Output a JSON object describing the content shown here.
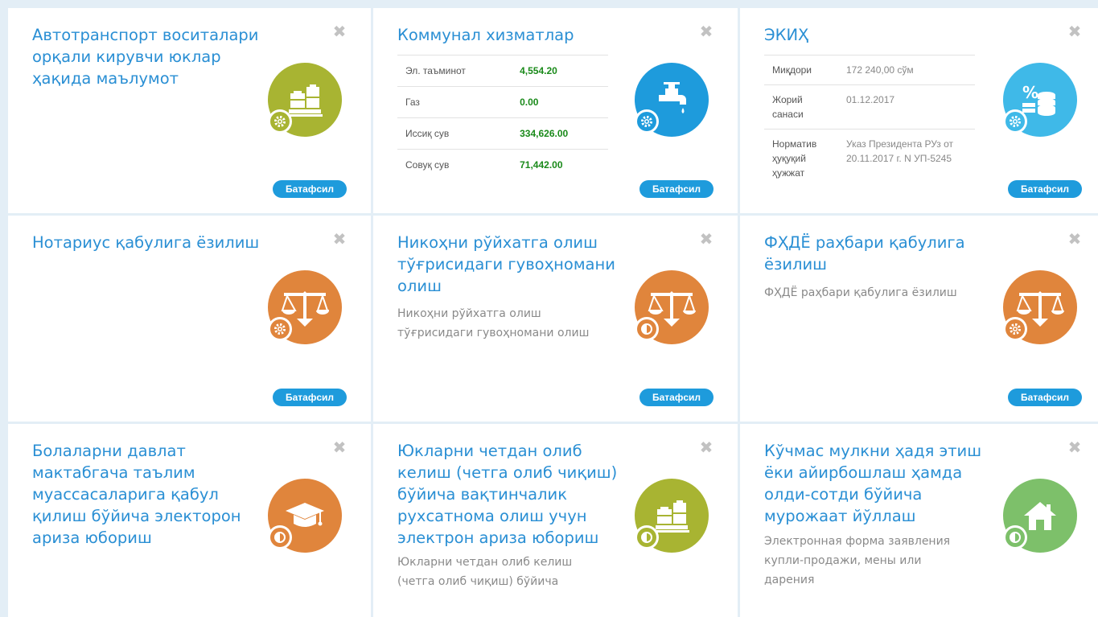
{
  "more_label": "Батафсил",
  "close_glyph": "✖",
  "cards": {
    "c1": {
      "title": "Автотранспорт воситалари орқали кирувчи юклар ҳақида маълумот",
      "icon": "cargo-icon",
      "badge": "gear-icon",
      "color": "#a8b432"
    },
    "c2": {
      "title": "Коммунал хизматлар",
      "icon": "water-tap-icon",
      "badge": "gear-icon",
      "color": "#1e9bdc",
      "rows": [
        {
          "label": "Эл. таъминот",
          "value": "4,554.20"
        },
        {
          "label": "Газ",
          "value": "0.00"
        },
        {
          "label": "Иссиқ сув",
          "value": "334,626.00"
        },
        {
          "label": "Совуқ сув",
          "value": "71,442.00"
        }
      ]
    },
    "c3": {
      "title": "ЭКИҲ",
      "icon": "percent-coins-icon",
      "badge": "gear-icon",
      "color": "#3fb9e8",
      "rows": [
        {
          "label": "Миқдори",
          "value": "172 240,00 сўм"
        },
        {
          "label": "Жорий санаси",
          "value": "01.12.2017"
        },
        {
          "label": "Норматив ҳуқуқий ҳужжат",
          "value": "Указ Президента РУз от 20.11.2017 г. N УП-5245"
        }
      ]
    },
    "c4": {
      "title": "Нотариус қабулига ёзилиш",
      "icon": "scales-icon",
      "badge": "gear-icon",
      "color": "#e0853c"
    },
    "c5": {
      "title": "Никоҳни рўйхатга олиш тўғрисидаги гувоҳномани олиш",
      "desc": "Никоҳни рўйхатга олиш тўғрисидаги гувоҳномани олиш",
      "icon": "scales-icon",
      "badge": "half-circle-icon",
      "color": "#e0853c"
    },
    "c6": {
      "title": "ФҲДЁ раҳбари қабулига ёзилиш",
      "desc": "ФҲДЁ раҳбари қабулига ёзилиш",
      "icon": "scales-icon",
      "badge": "gear-icon",
      "color": "#e0853c"
    },
    "c7": {
      "title": "Болаларни давлат мактабгача таълим муассасаларига қабул қилиш бўйича электорон ариза юбориш",
      "icon": "graduation-cap-icon",
      "badge": "half-circle-icon",
      "color": "#e0853c"
    },
    "c8": {
      "title": "Юкларни четдан олиб келиш (четга олиб чиқиш) бўйича вақтинчалик рухсатнома олиш учун электрон ариза юбориш",
      "desc": "Юкларни четдан олиб келиш (четга олиб чиқиш) бўйича",
      "icon": "cargo-icon",
      "badge": "half-circle-icon",
      "color": "#a8b432"
    },
    "c9": {
      "title": "Кўчмас мулкни ҳадя этиш ёки айирбошлаш ҳамда олди-сотди бўйича мурожаат йўллаш",
      "desc": "Электронная форма заявления купли-продажи, мены или дарения",
      "icon": "house-icon",
      "badge": "half-circle-icon",
      "color": "#7dc06a"
    }
  }
}
